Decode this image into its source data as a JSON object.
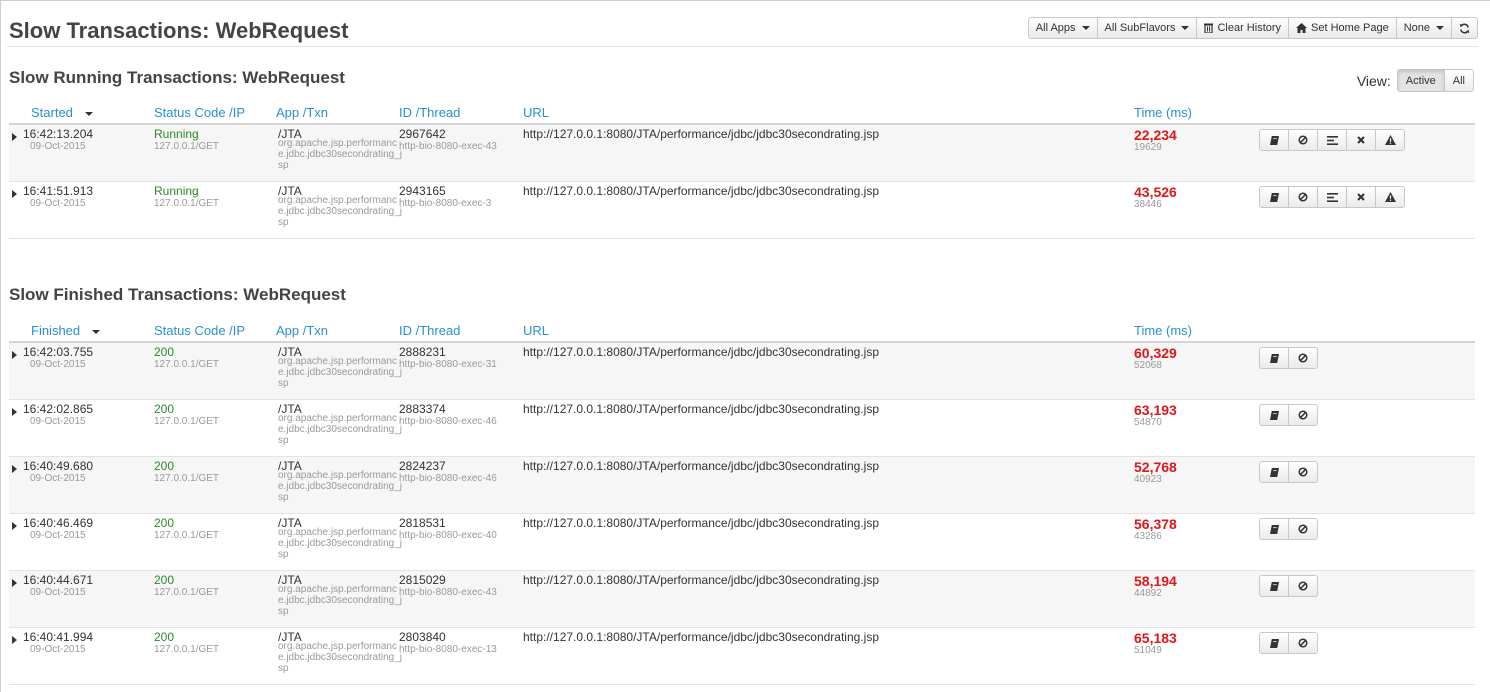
{
  "header": {
    "title": "Slow Transactions: WebRequest",
    "buttons": {
      "all_apps": "All Apps",
      "all_subflavors": "All SubFlavors",
      "clear_history": "Clear History",
      "set_home_page": "Set Home Page",
      "none": "None"
    },
    "icons": [
      "trash-icon",
      "home-icon",
      "refresh-icon"
    ]
  },
  "running": {
    "title": "Slow Running Transactions: WebRequest",
    "view_label": "View:",
    "view_active": "Active",
    "view_all": "All",
    "columns": {
      "started": "Started",
      "status": "Status Code /IP",
      "app": "App /Txn",
      "id": "ID /Thread",
      "url": "URL",
      "time": "Time (ms)"
    },
    "rows": [
      {
        "time": "16:42:13.204",
        "date": "09-Oct-2015",
        "status": "Running",
        "ip": "127.0.0.1/GET",
        "app": "/JTA",
        "txn": "org.apache.jsp.performance.jdbc.jdbc30secondrating_jsp",
        "id": "2967642",
        "thread": "http-bio-8080-exec-43",
        "url": "http://127.0.0.1:8080/JTA/performance/jdbc/jdbc30secondrating.jsp",
        "ms": "22,234",
        "cpu": "19629"
      },
      {
        "time": "16:41:51.913",
        "date": "09-Oct-2015",
        "status": "Running",
        "ip": "127.0.0.1/GET",
        "app": "/JTA",
        "txn": "org.apache.jsp.performance.jdbc.jdbc30secondrating_jsp",
        "id": "2943165",
        "thread": "http-bio-8080-exec-3",
        "url": "http://127.0.0.1:8080/JTA/performance/jdbc/jdbc30secondrating.jsp",
        "ms": "43,526",
        "cpu": "38446"
      }
    ]
  },
  "finished": {
    "title": "Slow Finished Transactions: WebRequest",
    "columns": {
      "finished": "Finished",
      "status": "Status Code /IP",
      "app": "App /Txn",
      "id": "ID /Thread",
      "url": "URL",
      "time": "Time (ms)"
    },
    "rows": [
      {
        "time": "16:42:03.755",
        "date": "09-Oct-2015",
        "status": "200",
        "ip": "127.0.0.1/GET",
        "app": "/JTA",
        "txn": "org.apache.jsp.performance.jdbc.jdbc30secondrating_jsp",
        "id": "2888231",
        "thread": "http-bio-8080-exec-31",
        "url": "http://127.0.0.1:8080/JTA/performance/jdbc/jdbc30secondrating.jsp",
        "ms": "60,329",
        "cpu": "52068"
      },
      {
        "time": "16:42:02.865",
        "date": "09-Oct-2015",
        "status": "200",
        "ip": "127.0.0.1/GET",
        "app": "/JTA",
        "txn": "org.apache.jsp.performance.jdbc.jdbc30secondrating_jsp",
        "id": "2883374",
        "thread": "http-bio-8080-exec-46",
        "url": "http://127.0.0.1:8080/JTA/performance/jdbc/jdbc30secondrating.jsp",
        "ms": "63,193",
        "cpu": "54870"
      },
      {
        "time": "16:40:49.680",
        "date": "09-Oct-2015",
        "status": "200",
        "ip": "127.0.0.1/GET",
        "app": "/JTA",
        "txn": "org.apache.jsp.performance.jdbc.jdbc30secondrating_jsp",
        "id": "2824237",
        "thread": "http-bio-8080-exec-46",
        "url": "http://127.0.0.1:8080/JTA/performance/jdbc/jdbc30secondrating.jsp",
        "ms": "52,768",
        "cpu": "40923"
      },
      {
        "time": "16:40:46.469",
        "date": "09-Oct-2015",
        "status": "200",
        "ip": "127.0.0.1/GET",
        "app": "/JTA",
        "txn": "org.apache.jsp.performance.jdbc.jdbc30secondrating_jsp",
        "id": "2818531",
        "thread": "http-bio-8080-exec-40",
        "url": "http://127.0.0.1:8080/JTA/performance/jdbc/jdbc30secondrating.jsp",
        "ms": "56,378",
        "cpu": "43286"
      },
      {
        "time": "16:40:44.671",
        "date": "09-Oct-2015",
        "status": "200",
        "ip": "127.0.0.1/GET",
        "app": "/JTA",
        "txn": "org.apache.jsp.performance.jdbc.jdbc30secondrating_jsp",
        "id": "2815029",
        "thread": "http-bio-8080-exec-43",
        "url": "http://127.0.0.1:8080/JTA/performance/jdbc/jdbc30secondrating.jsp",
        "ms": "58,194",
        "cpu": "44892"
      },
      {
        "time": "16:40:41.994",
        "date": "09-Oct-2015",
        "status": "200",
        "ip": "127.0.0.1/GET",
        "app": "/JTA",
        "txn": "org.apache.jsp.performance.jdbc.jdbc30secondrating_jsp",
        "id": "2803840",
        "thread": "http-bio-8080-exec-13",
        "url": "http://127.0.0.1:8080/JTA/performance/jdbc/jdbc30secondrating.jsp",
        "ms": "65,183",
        "cpu": "51049"
      }
    ]
  },
  "colors": {
    "link": "#2a8fd0",
    "running": "#2b8a2b",
    "slow_time": "#e0161b",
    "muted": "#999999"
  }
}
